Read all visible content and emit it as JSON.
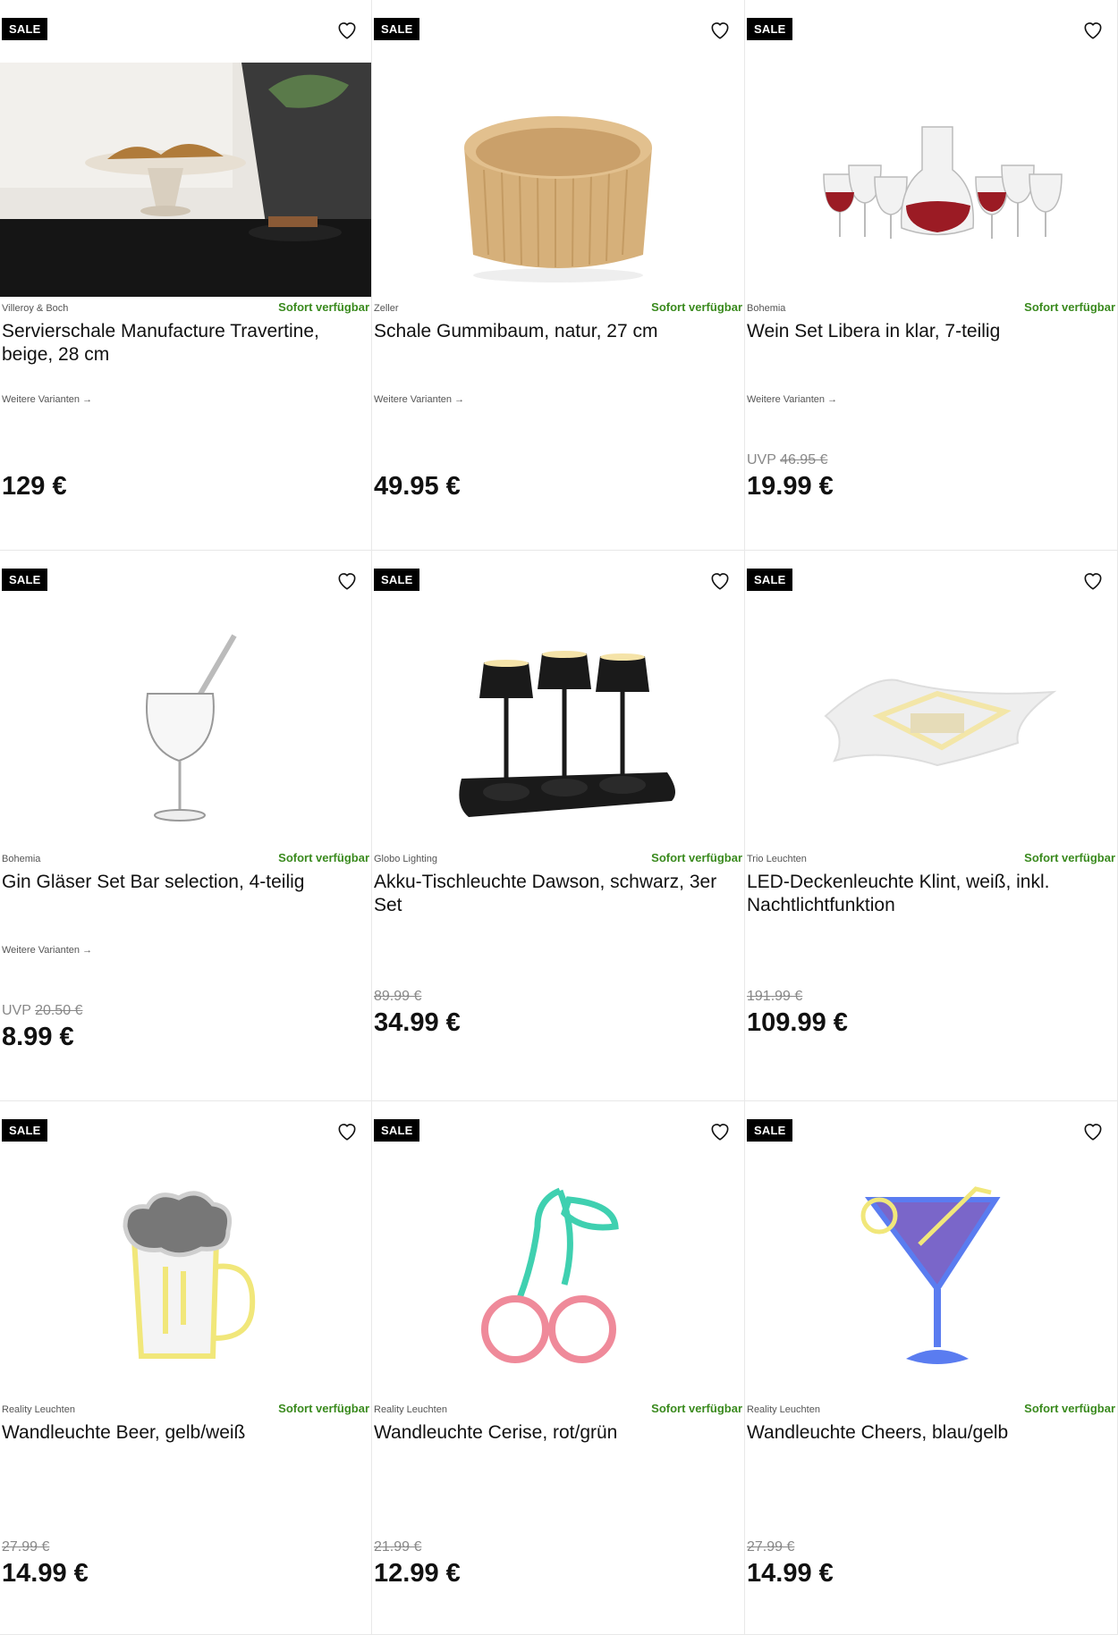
{
  "products": [
    {
      "badge": "SALE",
      "brand": "Villeroy & Boch",
      "availability": "Sofort verfügbar",
      "title": "Servierschale Manufacture Travertine, beige, 28 cm",
      "variants": "Weitere Varianten →",
      "old_prefix": "",
      "old_price": "",
      "price": "129 €",
      "image": "serving-bowl-photo"
    },
    {
      "badge": "SALE",
      "brand": "Zeller",
      "availability": "Sofort verfügbar",
      "title": "Schale Gummibaum, natur, 27 cm",
      "variants": "Weitere Varianten →",
      "old_prefix": "",
      "old_price": "",
      "price": "49.95 €",
      "image": "wooden-bowl"
    },
    {
      "badge": "SALE",
      "brand": "Bohemia",
      "availability": "Sofort verfügbar",
      "title": "Wein Set Libera in klar, 7-teilig",
      "variants": "Weitere Varianten →",
      "old_prefix": "UVP",
      "old_price": "46.95 €",
      "price": "19.99 €",
      "image": "wine-set"
    },
    {
      "badge": "SALE",
      "brand": "Bohemia",
      "availability": "Sofort verfügbar",
      "title": "Gin Gläser Set Bar selection, 4-teilig",
      "variants": "Weitere Varianten →",
      "old_prefix": "UVP",
      "old_price": "20.50 €",
      "price": "8.99 €",
      "image": "gin-glass"
    },
    {
      "badge": "SALE",
      "brand": "Globo Lighting",
      "availability": "Sofort verfügbar",
      "title": "Akku-Tischleuchte Dawson, schwarz, 3er Set",
      "variants": "",
      "old_prefix": "",
      "old_price": "89.99 €",
      "price": "34.99 €",
      "image": "table-lamps"
    },
    {
      "badge": "SALE",
      "brand": "Trio Leuchten",
      "availability": "Sofort verfügbar",
      "title": "LED-Deckenleuchte Klint, weiß, inkl. Nachtlichtfunktion",
      "variants": "",
      "old_prefix": "",
      "old_price": "191.99 €",
      "price": "109.99 €",
      "image": "ceiling-light"
    },
    {
      "badge": "SALE",
      "brand": "Reality Leuchten",
      "availability": "Sofort verfügbar",
      "title": "Wandleuchte Beer, gelb/weiß",
      "variants": "",
      "old_prefix": "",
      "old_price": "27.99 €",
      "price": "14.99 €",
      "image": "neon-beer"
    },
    {
      "badge": "SALE",
      "brand": "Reality Leuchten",
      "availability": "Sofort verfügbar",
      "title": "Wandleuchte Cerise, rot/grün",
      "variants": "",
      "old_prefix": "",
      "old_price": "21.99 €",
      "price": "12.99 €",
      "image": "neon-cherry"
    },
    {
      "badge": "SALE",
      "brand": "Reality Leuchten",
      "availability": "Sofort verfügbar",
      "title": "Wandleuchte Cheers, blau/gelb",
      "variants": "",
      "old_prefix": "",
      "old_price": "27.99 €",
      "price": "14.99 €",
      "image": "neon-cocktail"
    }
  ],
  "colors": {
    "availability": "#3a8a1e",
    "badge_bg": "#000000"
  }
}
